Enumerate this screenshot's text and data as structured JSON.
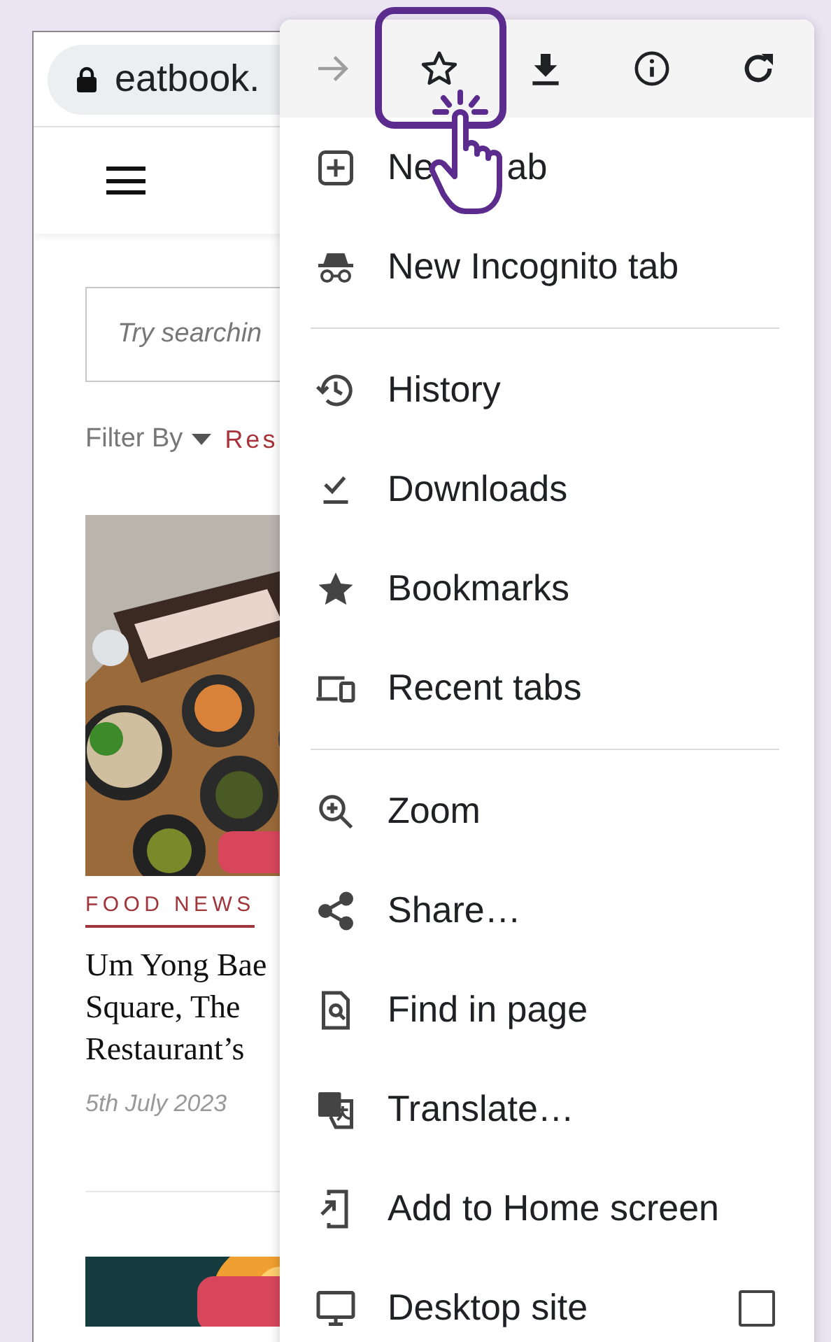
{
  "browser": {
    "url": "eatbook."
  },
  "page": {
    "search": {
      "placeholder": "Try searchin"
    },
    "filter": {
      "label": "Filter By",
      "value": "Res"
    },
    "article": {
      "category": "FOOD NEWS",
      "title": "Um Yong Bae\nSquare, The\nRestaurant’s",
      "date": "5th July 2023"
    }
  },
  "menu": {
    "toolbar": [
      {
        "kind": "forward",
        "disabled": true,
        "highlighted": false
      },
      {
        "kind": "bookmark",
        "disabled": false,
        "highlighted": true
      },
      {
        "kind": "download",
        "disabled": false,
        "highlighted": false
      },
      {
        "kind": "info",
        "disabled": false,
        "highlighted": false
      },
      {
        "kind": "reload",
        "disabled": false,
        "highlighted": false
      }
    ],
    "sections": [
      [
        {
          "kind": "split",
          "label_parts": [
            "Ne",
            "ab"
          ]
        },
        {
          "kind": "item",
          "label": "New Incognito tab"
        }
      ],
      [
        {
          "kind": "item",
          "label": "History"
        },
        {
          "kind": "item",
          "label": "Downloads"
        },
        {
          "kind": "item",
          "label": "Bookmarks"
        },
        {
          "kind": "item",
          "label": "Recent tabs"
        }
      ],
      [
        {
          "kind": "item",
          "label": "Zoom"
        },
        {
          "kind": "item",
          "label": "Share…"
        },
        {
          "kind": "item",
          "label": "Find in page"
        },
        {
          "kind": "item",
          "label": "Translate…"
        },
        {
          "kind": "item",
          "label": "Add to Home screen"
        },
        {
          "kind": "checkbox",
          "label": "Desktop site",
          "checked": false
        }
      ]
    ]
  }
}
